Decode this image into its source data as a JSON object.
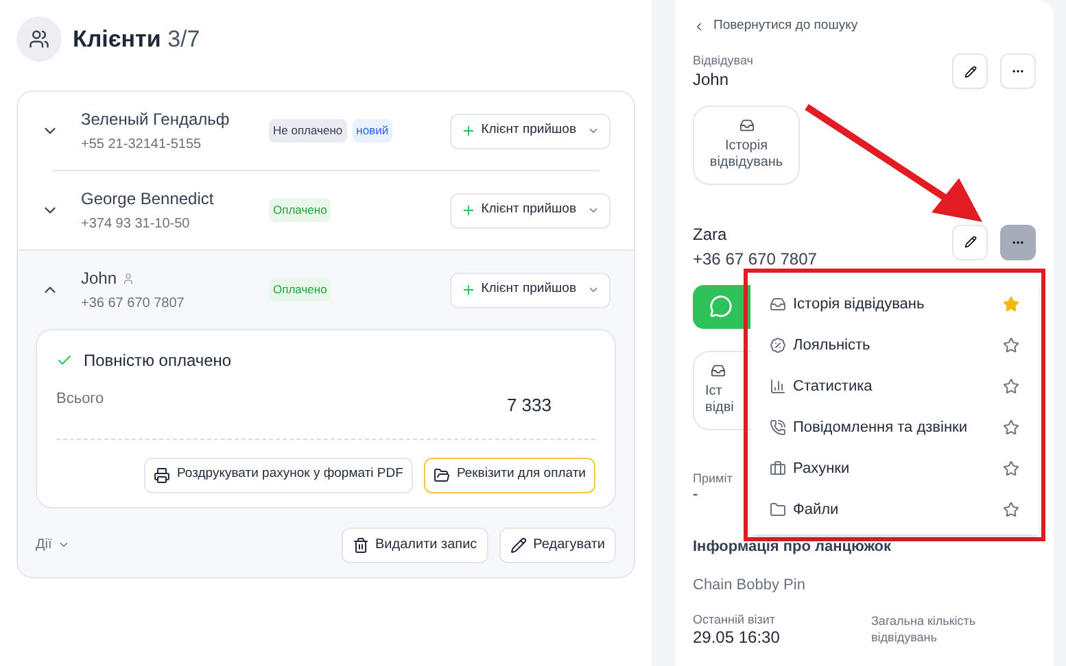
{
  "header": {
    "title": "Клієнти",
    "count": "3/7"
  },
  "clients": [
    {
      "name": "Зеленый Гендальф",
      "phone": "+55 21-32141-5155",
      "person_icon": false,
      "expanded": false,
      "badges": [
        {
          "label": "Не оплачено",
          "kind": "unpaid"
        },
        {
          "label": "новий",
          "kind": "new"
        }
      ],
      "action": "Клієнт прийшов"
    },
    {
      "name": "George Bennedict",
      "phone": "+374 93 31-10-50",
      "person_icon": false,
      "expanded": false,
      "badges": [
        {
          "label": "Оплачено",
          "kind": "paid"
        }
      ],
      "action": "Клієнт прийшов"
    },
    {
      "name": "John",
      "phone": "+36 67 670 7807",
      "person_icon": true,
      "expanded": true,
      "badges": [
        {
          "label": "Оплачено",
          "kind": "paid"
        }
      ],
      "action": "Клієнт прийшов",
      "details": {
        "status": "Повністю оплачено",
        "total_label": "Всього",
        "total": "7 333",
        "buttons": [
          {
            "label": "Роздрукувати рахунок у форматі PDF",
            "kind": "print"
          },
          {
            "label": "Реквізити для оплати",
            "kind": "folder"
          }
        ]
      }
    }
  ],
  "footer": {
    "actions_label": "Дії",
    "buttons": [
      {
        "label": "Видалити запис",
        "kind": "delete"
      },
      {
        "label": "Редагувати",
        "kind": "edit"
      }
    ]
  },
  "side": {
    "back": "Повернутися до пошуку",
    "visitor_label": "Відвідувач",
    "visitor": "John",
    "history_card": [
      "Історія",
      "відвідувань"
    ],
    "contact_name": "Zara",
    "contact_phone": "+36 67 670 7807",
    "contact_history_card": [
      "Іст",
      "відві"
    ],
    "notes_label": "Приміт",
    "notes": "-",
    "chain_title": "Інформація про ланцюжок",
    "chain": "Chain Bobby Pin",
    "last_visit_label": "Останній візит",
    "last_visit": "29.05 16:30",
    "total_visits_label": "Загальна кількість відвідувань"
  },
  "menu": {
    "items": [
      {
        "label": "Історія відвідувань",
        "starred": true
      },
      {
        "label": "Лояльність",
        "starred": false
      },
      {
        "label": "Статистика",
        "starred": false
      },
      {
        "label": "Повідомлення та дзвінки",
        "starred": false
      },
      {
        "label": "Рахунки",
        "starred": false
      },
      {
        "label": "Файли",
        "starred": false
      }
    ]
  }
}
